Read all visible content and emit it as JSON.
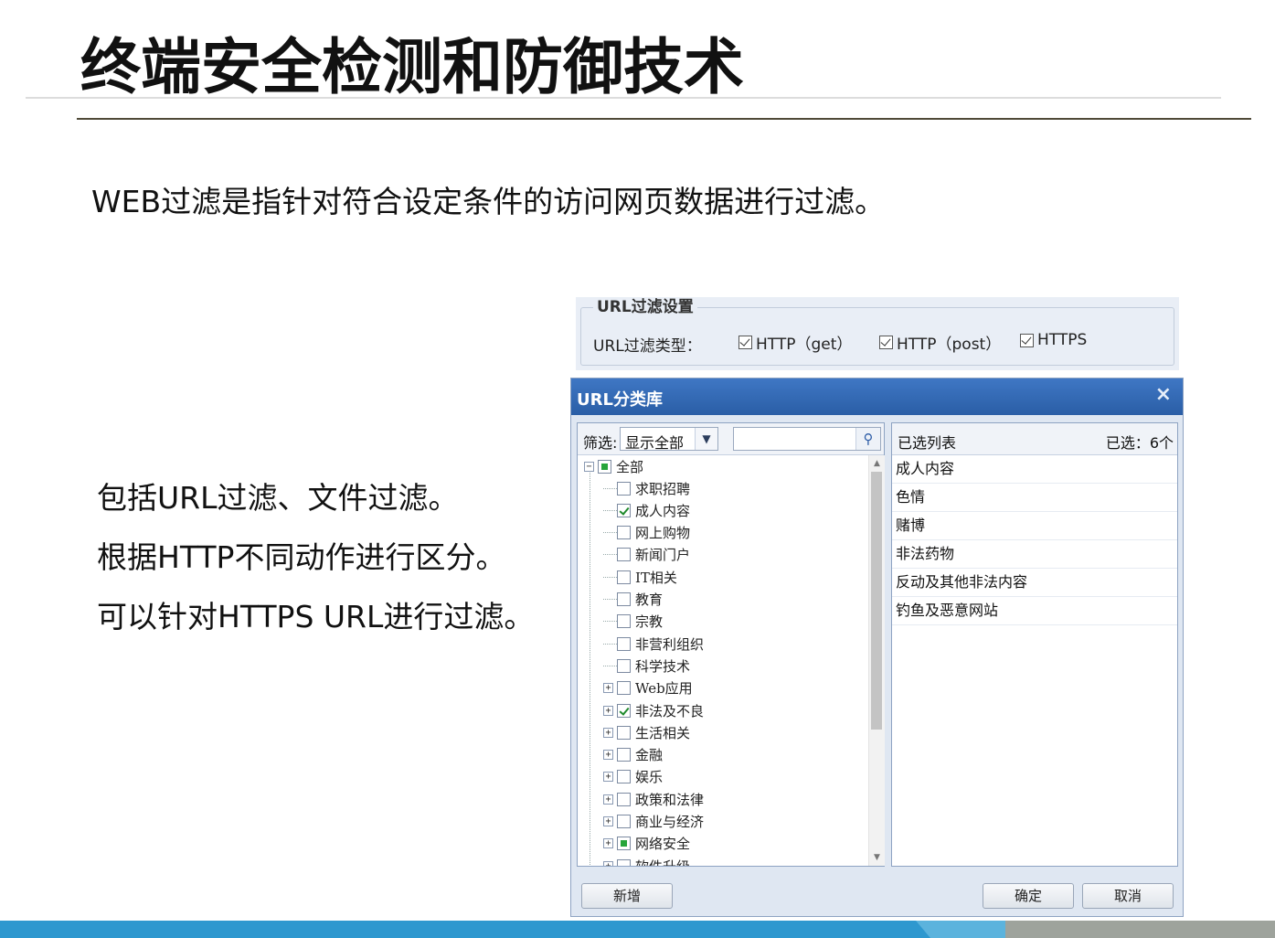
{
  "slide": {
    "title": "终端安全检测和防御技术",
    "intro": "WEB过滤是指针对符合设定条件的访问网页数据进行过滤。",
    "bullets": [
      "包括URL过滤、文件过滤。",
      "根据HTTP不同动作进行区分。",
      "可以针对HTTPS URL进行过滤。"
    ]
  },
  "url_settings": {
    "legend": "URL过滤设置",
    "type_label": "URL过滤类型：",
    "options": [
      {
        "label": "HTTP（get）",
        "checked": true
      },
      {
        "label": "HTTP（post）",
        "checked": true
      },
      {
        "label": "HTTPS",
        "checked": true
      }
    ]
  },
  "dialog": {
    "title": "URL分类库",
    "close": "×",
    "filter_label": "筛选:",
    "filter_value": "显示全部",
    "search_placeholder": "",
    "tree": {
      "root": {
        "label": "全部",
        "state": "partial"
      },
      "items": [
        {
          "label": "求职招聘",
          "state": "unchecked",
          "expandable": false
        },
        {
          "label": "成人内容",
          "state": "checked",
          "expandable": false
        },
        {
          "label": "网上购物",
          "state": "unchecked",
          "expandable": false
        },
        {
          "label": "新闻门户",
          "state": "unchecked",
          "expandable": false
        },
        {
          "label": "IT相关",
          "state": "unchecked",
          "expandable": false
        },
        {
          "label": "教育",
          "state": "unchecked",
          "expandable": false
        },
        {
          "label": "宗教",
          "state": "unchecked",
          "expandable": false
        },
        {
          "label": "非营利组织",
          "state": "unchecked",
          "expandable": false
        },
        {
          "label": "科学技术",
          "state": "unchecked",
          "expandable": false
        },
        {
          "label": "Web应用",
          "state": "unchecked",
          "expandable": true
        },
        {
          "label": "非法及不良",
          "state": "checked",
          "expandable": true
        },
        {
          "label": "生活相关",
          "state": "unchecked",
          "expandable": true
        },
        {
          "label": "金融",
          "state": "unchecked",
          "expandable": true
        },
        {
          "label": "娱乐",
          "state": "unchecked",
          "expandable": true
        },
        {
          "label": "政策和法律",
          "state": "unchecked",
          "expandable": true
        },
        {
          "label": "商业与经济",
          "state": "unchecked",
          "expandable": true
        },
        {
          "label": "网络安全",
          "state": "partial",
          "expandable": true
        },
        {
          "label": "软件升级",
          "state": "unchecked",
          "expandable": true
        }
      ]
    },
    "selected_header": "已选列表",
    "selected_count": "已选：6个",
    "selected": [
      "成人内容",
      "色情",
      "赌博",
      "非法药物",
      "反动及其他非法内容",
      "钓鱼及恶意网站"
    ],
    "buttons": {
      "add": "新增",
      "ok": "确定",
      "cancel": "取消"
    }
  },
  "colors": {
    "titlebar": "#2a5ea6",
    "footer": "#2e98cf",
    "check": "#1f8a2c"
  }
}
